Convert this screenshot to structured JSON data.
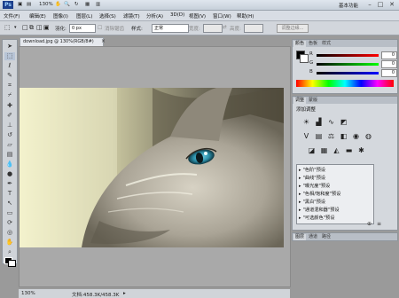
{
  "titlebar": {
    "logo": "Ps",
    "zoom": "130%",
    "workspace": "基本功能",
    "minimize": "–",
    "maximize": "□",
    "close": "✕"
  },
  "menubar": {
    "items": [
      "文件(F)",
      "编辑(E)",
      "图像(I)",
      "图层(L)",
      "选择(S)",
      "滤镜(T)",
      "分析(A)",
      "3D(D)",
      "视图(V)",
      "窗口(W)",
      "帮助(H)"
    ]
  },
  "options": {
    "feather_label": "羽化:",
    "feather_value": "0 px",
    "antialias_label": "消除锯齿",
    "style_label": "样式:",
    "style_value": "正常",
    "width_label": "宽度:",
    "height_label": "高度:",
    "refine_button": "调整边缘..."
  },
  "document": {
    "tab_title": "download.jpg @ 130%(RGB/8#)"
  },
  "status": {
    "zoom": "130%",
    "doc_size": "文档:458.3K/458.3K"
  },
  "color_panel": {
    "tabs": [
      "颜色",
      "色板",
      "样式"
    ],
    "r_label": "R",
    "g_label": "G",
    "b_label": "B",
    "r_value": "0",
    "g_value": "0",
    "b_value": "0"
  },
  "adjust_panel": {
    "tabs": [
      "调整",
      "蒙版"
    ],
    "title": "添加调整",
    "presets": [
      "\"色阶\"预设",
      "\"曲线\"预设",
      "\"曝光度\"预设",
      "\"色相/饱和度\"预设",
      "\"黑白\"预设",
      "\"通道混和器\"预设",
      "\"可选颜色\"预设"
    ]
  },
  "layers_panel": {
    "tabs": [
      "图层",
      "通道",
      "路径"
    ]
  },
  "colors": {
    "accent": "#1c3f8c"
  }
}
